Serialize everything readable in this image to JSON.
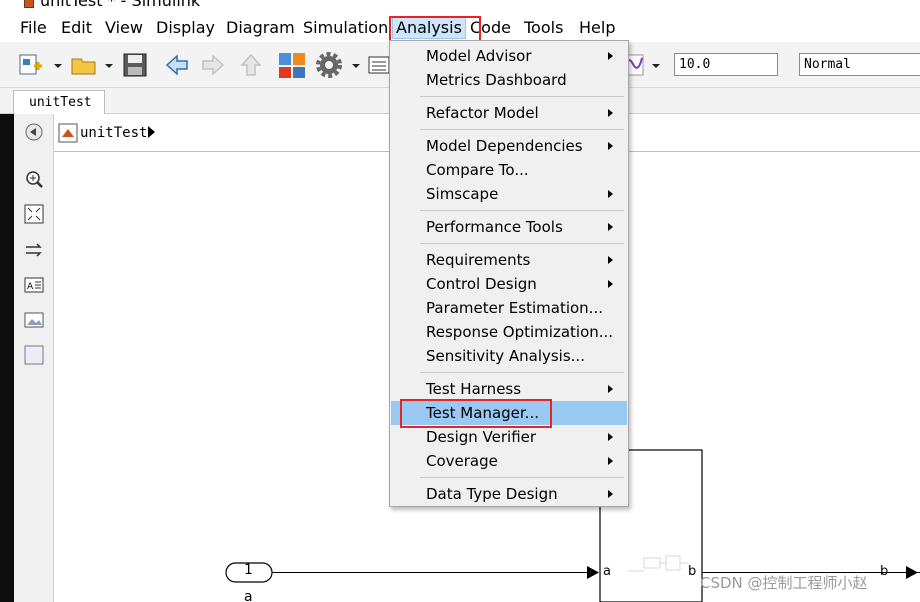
{
  "window": {
    "title": "unitTest * - Simulink"
  },
  "menubar": {
    "items": [
      "File",
      "Edit",
      "View",
      "Display",
      "Diagram",
      "Simulation",
      "Analysis",
      "Code",
      "Tools",
      "Help"
    ],
    "active": "Analysis"
  },
  "toolbar": {
    "stop_time": "10.0",
    "sim_mode": "Normal"
  },
  "tabs": [
    {
      "label": "unitTest"
    }
  ],
  "breadcrumb": {
    "model": "unitTest"
  },
  "analysis_menu": {
    "items": [
      {
        "label": "Model Advisor",
        "submenu": true
      },
      {
        "label": "Metrics Dashboard",
        "submenu": false
      },
      {
        "label": "Refactor Model",
        "submenu": true
      },
      {
        "label": "Model Dependencies",
        "submenu": true
      },
      {
        "label": "Compare To...",
        "submenu": false
      },
      {
        "label": "Simscape",
        "submenu": true
      },
      {
        "label": "Performance Tools",
        "submenu": true
      },
      {
        "label": "Requirements",
        "submenu": true
      },
      {
        "label": "Control Design",
        "submenu": true
      },
      {
        "label": "Parameter Estimation...",
        "submenu": false
      },
      {
        "label": "Response Optimization...",
        "submenu": false
      },
      {
        "label": "Sensitivity Analysis...",
        "submenu": false
      },
      {
        "label": "Test Harness",
        "submenu": true
      },
      {
        "label": "Test Manager...",
        "submenu": false,
        "highlighted": true
      },
      {
        "label": "Design Verifier",
        "submenu": true
      },
      {
        "label": "Coverage",
        "submenu": true
      },
      {
        "label": "Data Type Design",
        "submenu": true
      }
    ]
  },
  "diagram": {
    "inport": {
      "number": "1",
      "name": "a"
    },
    "subsystem": {
      "in_port": "a",
      "out_port": "b"
    },
    "outport_label": "b"
  },
  "watermark": "CSDN @控制工程师小赵",
  "colors": {
    "highlight": "#99c9f2",
    "annotation_box": "#e22525",
    "menu_bg": "#f0f0f0"
  }
}
